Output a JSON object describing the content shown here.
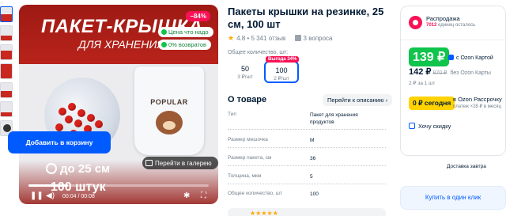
{
  "gallery": {
    "title_line1": "ПАКЕТ-КРЫШКА",
    "title_line2": "ДЛЯ ХРАНЕНИЯ",
    "discount_badge": "−84%",
    "pill_price": "Цена что надо",
    "pill_returns": "0% возвратов",
    "bag_print": "POPULAR",
    "gallery_button": "Перейти в галерею",
    "size_text": "до 25 см",
    "count_text": "100 штук",
    "time": "00:04 / 00:08",
    "video_progress": 0.22
  },
  "product": {
    "title": "Пакеты крышки на резинке, 25 см, 100 шт",
    "rating": "4.8",
    "reviews": "5 341 отзыв",
    "questions": "3 вопроса",
    "variant_label": "Общее количество, шт:",
    "variants": [
      {
        "value": "50",
        "price": "3 ₽/шт"
      },
      {
        "value": "100",
        "price": "2 ₽/шт",
        "badge": "Выгода 34%"
      }
    ]
  },
  "about": {
    "heading": "О товаре",
    "link": "Перейти к описанию",
    "specs": [
      {
        "label": "Тип",
        "value": "Пакет для хранения продуктов"
      },
      {
        "label": "Размер мешочка",
        "value": "М"
      },
      {
        "label": "Размер пакета, см",
        "value": "36"
      },
      {
        "label": "Толщина, мкм",
        "value": "5"
      },
      {
        "label": "Общее количество, шт",
        "value": "100"
      }
    ]
  },
  "buybox": {
    "promo_title": "Распродажа",
    "promo_units": "7012",
    "promo_units_suffix": "единиц осталось",
    "price_card": "139 ₽",
    "price_card_note": "с Ozon Картой",
    "price": "142 ₽",
    "price_old": "870 ₽",
    "price_note": "без Ozon Карты",
    "price_per": "2 ₽ за 1 шт",
    "install_amount": "0 ₽ сегодня",
    "install_title": "в Ozon Рассрочку",
    "install_sub": "платеж ×28 ₽ в месяц",
    "discount_link": "Хочу скидку",
    "cart_button": "Добавить в корзину",
    "delivery": "Доставка завтра",
    "one_click": "Купить в один клик"
  },
  "colors": {
    "accent": "#005bff",
    "sale": "#f91155",
    "ozon_green": "#10c44c",
    "install_yellow": "#ffd200"
  }
}
